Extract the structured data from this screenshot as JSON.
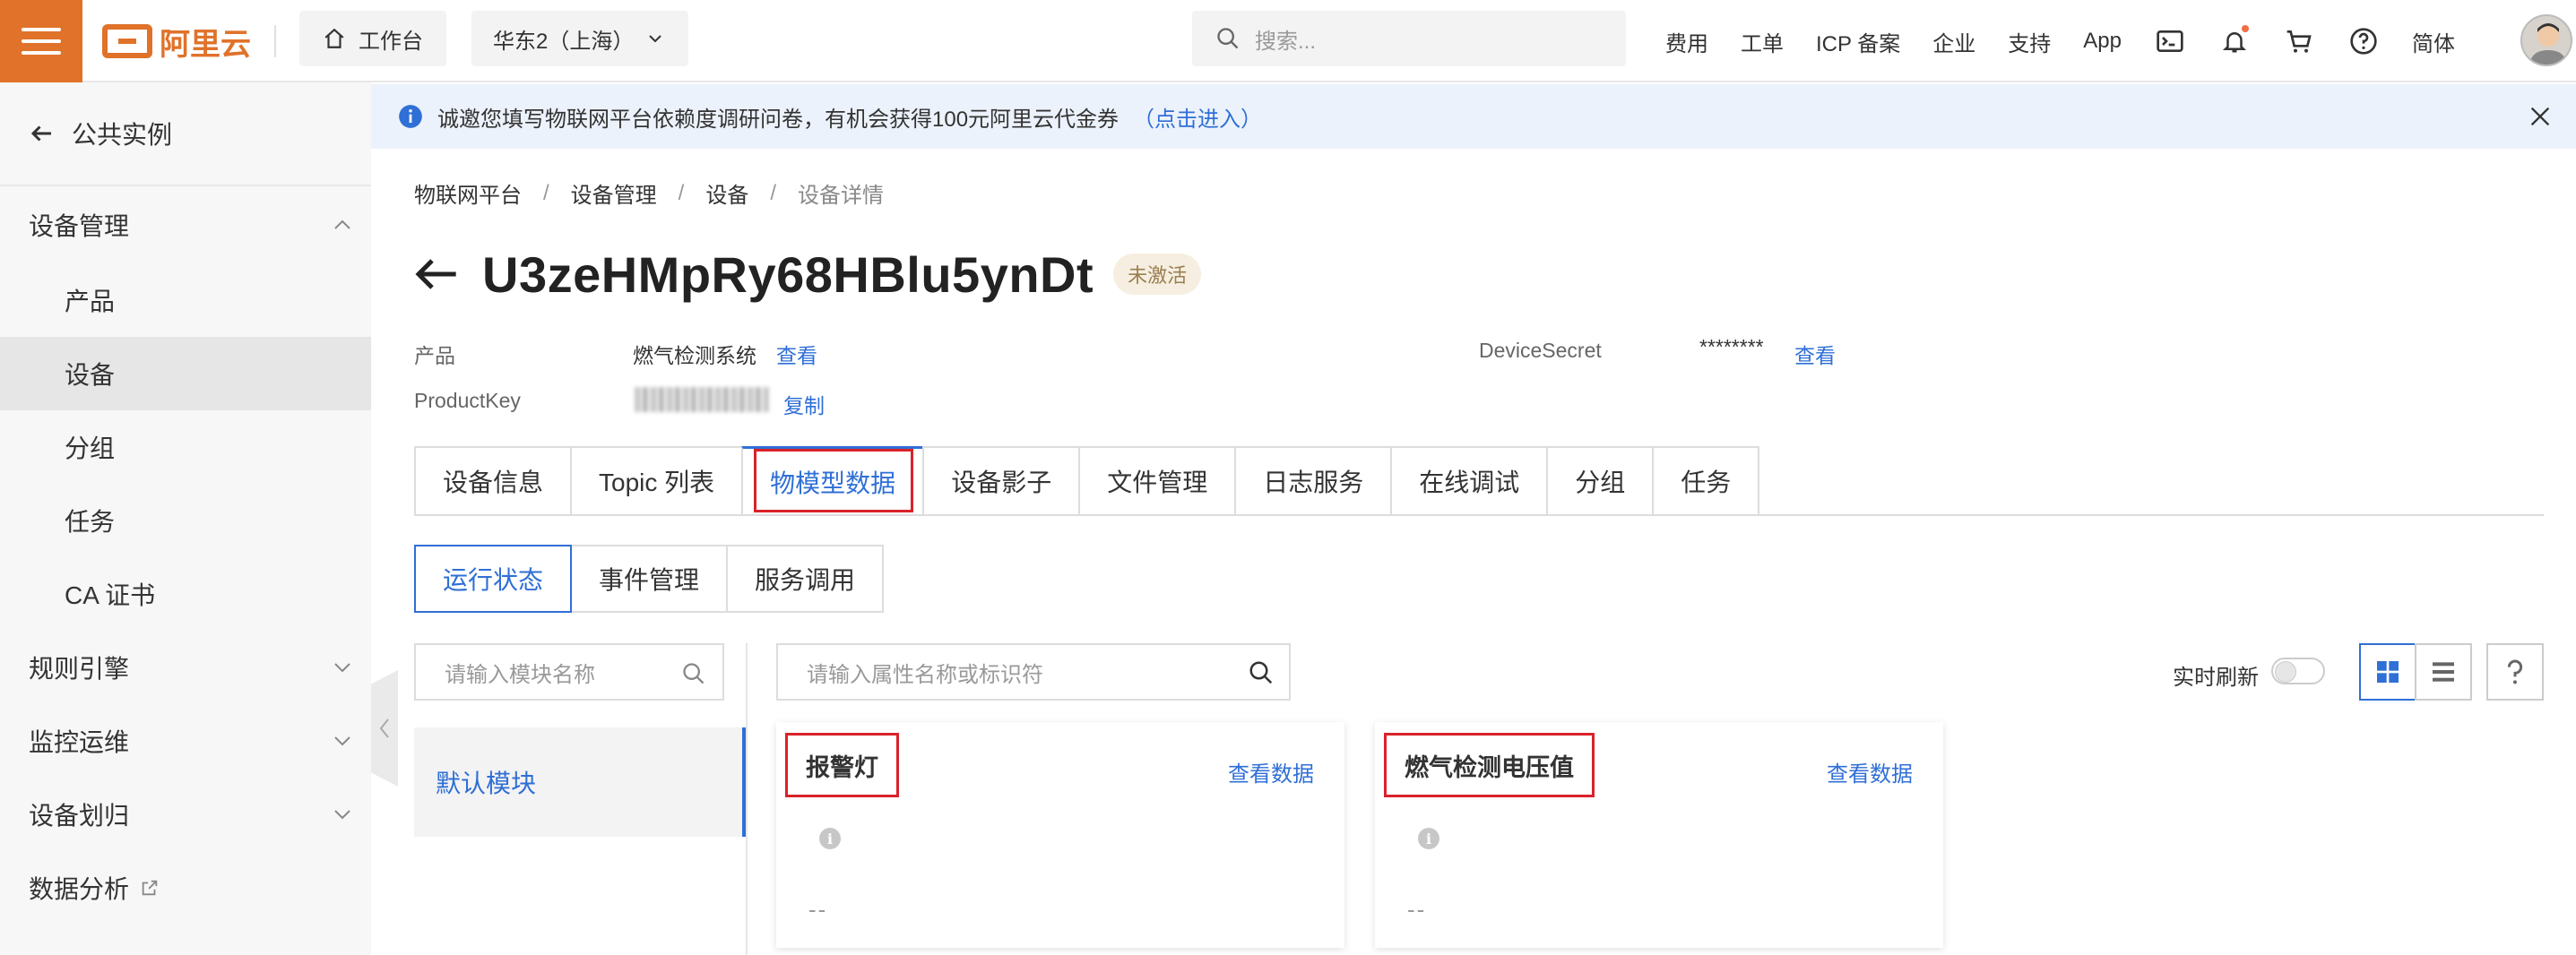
{
  "topbar": {
    "logo_text": "阿里云",
    "workbench": "工作台",
    "region": "华东2（上海）",
    "search_placeholder": "搜索...",
    "nav": [
      "费用",
      "工单",
      "ICP 备案",
      "企业",
      "支持",
      "App"
    ],
    "lang": "简体"
  },
  "sidebar": {
    "back_label": "公共实例",
    "items": [
      {
        "label": "设备管理"
      },
      {
        "label": "产品"
      },
      {
        "label": "设备"
      },
      {
        "label": "分组"
      },
      {
        "label": "任务"
      },
      {
        "label": "CA 证书"
      },
      {
        "label": "规则引擎"
      },
      {
        "label": "监控运维"
      },
      {
        "label": "设备划归"
      },
      {
        "label": "数据分析"
      }
    ]
  },
  "notice": {
    "text": "诚邀您填写物联网平台依赖度调研问卷，有机会获得100元阿里云代金券",
    "link": "（点击进入）"
  },
  "breadcrumb": [
    "物联网平台",
    "设备管理",
    "设备",
    "设备详情"
  ],
  "device": {
    "name": "U3zeHMpRy68HBlu5ynDt",
    "status": "未激活",
    "product_label": "产品",
    "product_value": "燃气检测系统",
    "product_link": "查看",
    "productkey_label": "ProductKey",
    "productkey_link": "复制",
    "secret_label": "DeviceSecret",
    "secret_value": "********",
    "secret_link": "查看"
  },
  "tabs": [
    "设备信息",
    "Topic 列表",
    "物模型数据",
    "设备影子",
    "文件管理",
    "日志服务",
    "在线调试",
    "分组",
    "任务"
  ],
  "subtabs": [
    "运行状态",
    "事件管理",
    "服务调用"
  ],
  "module_search_placeholder": "请输入模块名称",
  "module_default": "默认模块",
  "prop_search_placeholder": "请输入属性名称或标识符",
  "refresh_label": "实时刷新",
  "cards": [
    {
      "name": "报警灯",
      "link": "查看数据",
      "value": "--"
    },
    {
      "name": "燃气检测电压值",
      "link": "查看数据",
      "value": "--"
    }
  ],
  "colors": {
    "accent": "#e0722a",
    "link": "#2f6fd6",
    "highlight": "#d9222a"
  }
}
